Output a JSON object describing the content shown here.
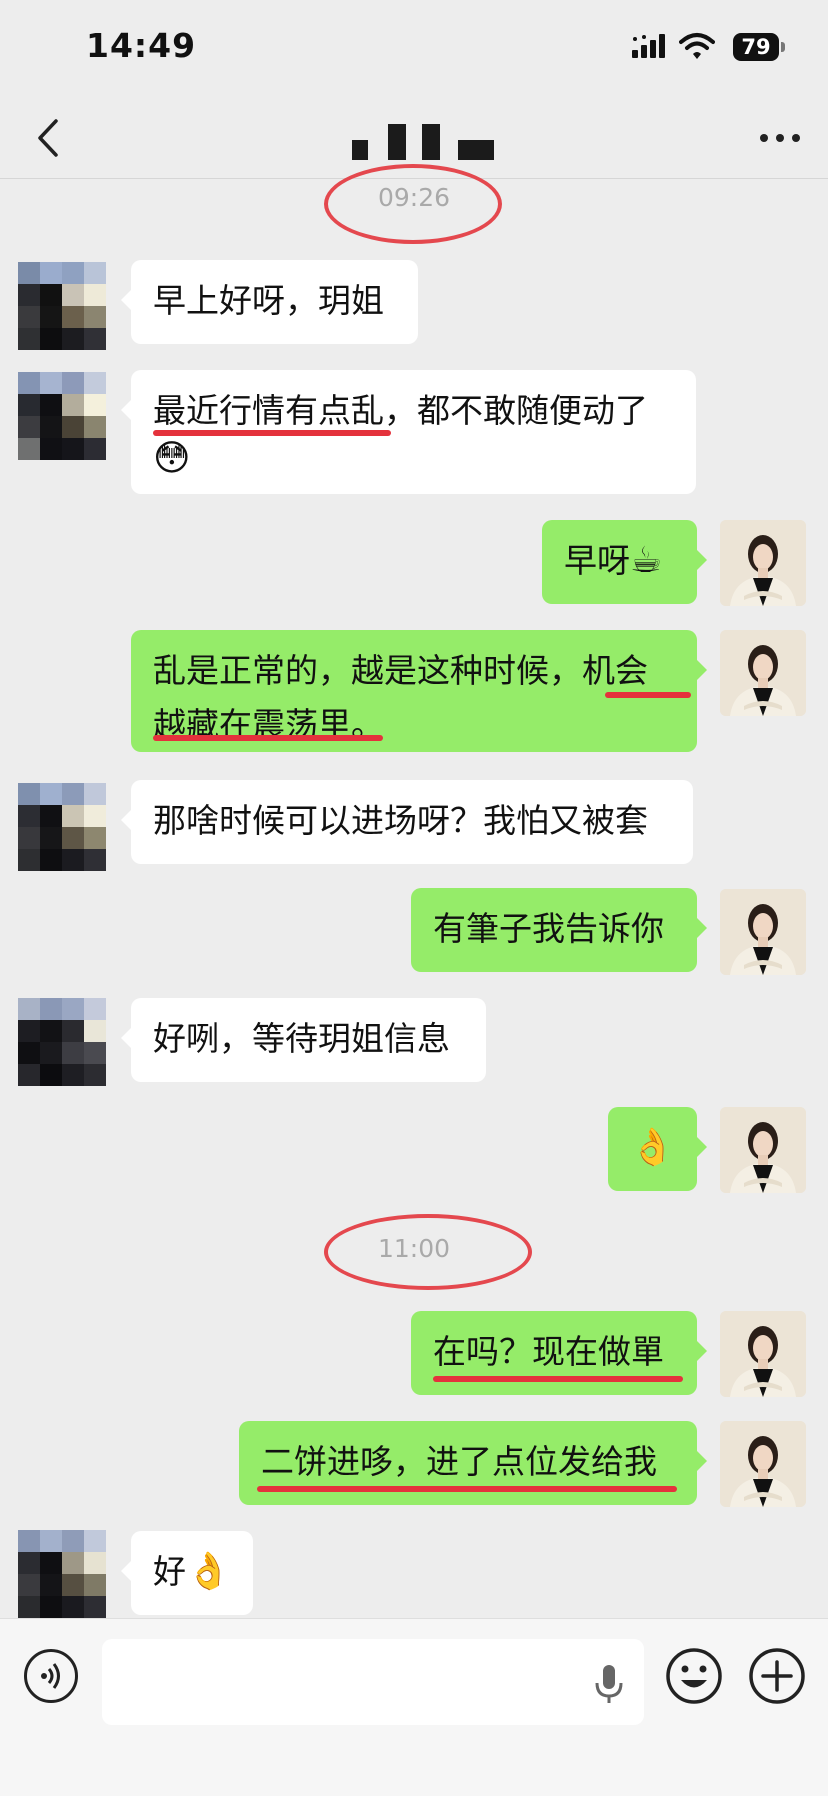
{
  "status_bar": {
    "time": "14:49",
    "battery": "79"
  },
  "header": {
    "back_icon": "chevron-left-icon",
    "more_icon": "ellipsis-icon"
  },
  "timestamps": [
    "09:26",
    "11:00"
  ],
  "messages": [
    {
      "from": "other",
      "text": "早上好呀，玥姐"
    },
    {
      "from": "other",
      "line1": "最近行情有点乱，都不敢随便动了",
      "emoji": "😳"
    },
    {
      "from": "me",
      "text": "早呀",
      "emoji": "☕"
    },
    {
      "from": "me",
      "line1": "乱是正常的，越是这种时候，机会",
      "line2": "越藏在震荡里。"
    },
    {
      "from": "other",
      "text": "那啥时候可以进场呀？我怕又被套"
    },
    {
      "from": "me",
      "text": "有筆子我告诉你"
    },
    {
      "from": "other",
      "text": "好咧，等待玥姐信息"
    },
    {
      "from": "me",
      "emoji": "👌"
    },
    {
      "from": "me",
      "text": "在吗？现在做單"
    },
    {
      "from": "me",
      "text": "二饼进哆，进了点位发给我"
    },
    {
      "from": "other",
      "text": "好",
      "emoji": "👌"
    }
  ],
  "input_bar": {
    "placeholder": "",
    "voice_icon": "voice-icon",
    "mic_icon": "mic-icon",
    "emoji_icon": "smiley-icon",
    "plus_icon": "plus-circle-icon"
  },
  "colors": {
    "background": "#ededed",
    "outgoing_bubble": "#95ec69",
    "incoming_bubble": "#ffffff",
    "annotation_red": "#e4323c"
  }
}
